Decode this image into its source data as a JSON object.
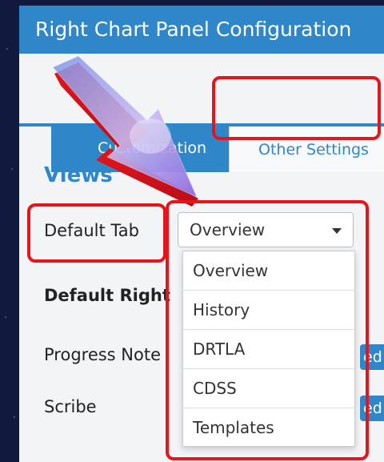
{
  "panel": {
    "title": "Right Chart Panel Configuration",
    "tabs": [
      {
        "label": "Customization",
        "active": true
      },
      {
        "label": "Other Settings",
        "active": false
      }
    ]
  },
  "views": {
    "title": "Views",
    "default_tab_label": "Default Tab",
    "default_right_label": "Default Right",
    "progress_notes_label": "Progress Note",
    "scribe_label": "Scribe",
    "toggle_text": "ed"
  },
  "select": {
    "value": "Overview",
    "options": [
      "Overview",
      "History",
      "DRTLA",
      "CDSS",
      "Templates"
    ]
  },
  "colors": {
    "brand": "#2f86c8",
    "highlight": "#e8141c",
    "background": "#101a3e"
  }
}
